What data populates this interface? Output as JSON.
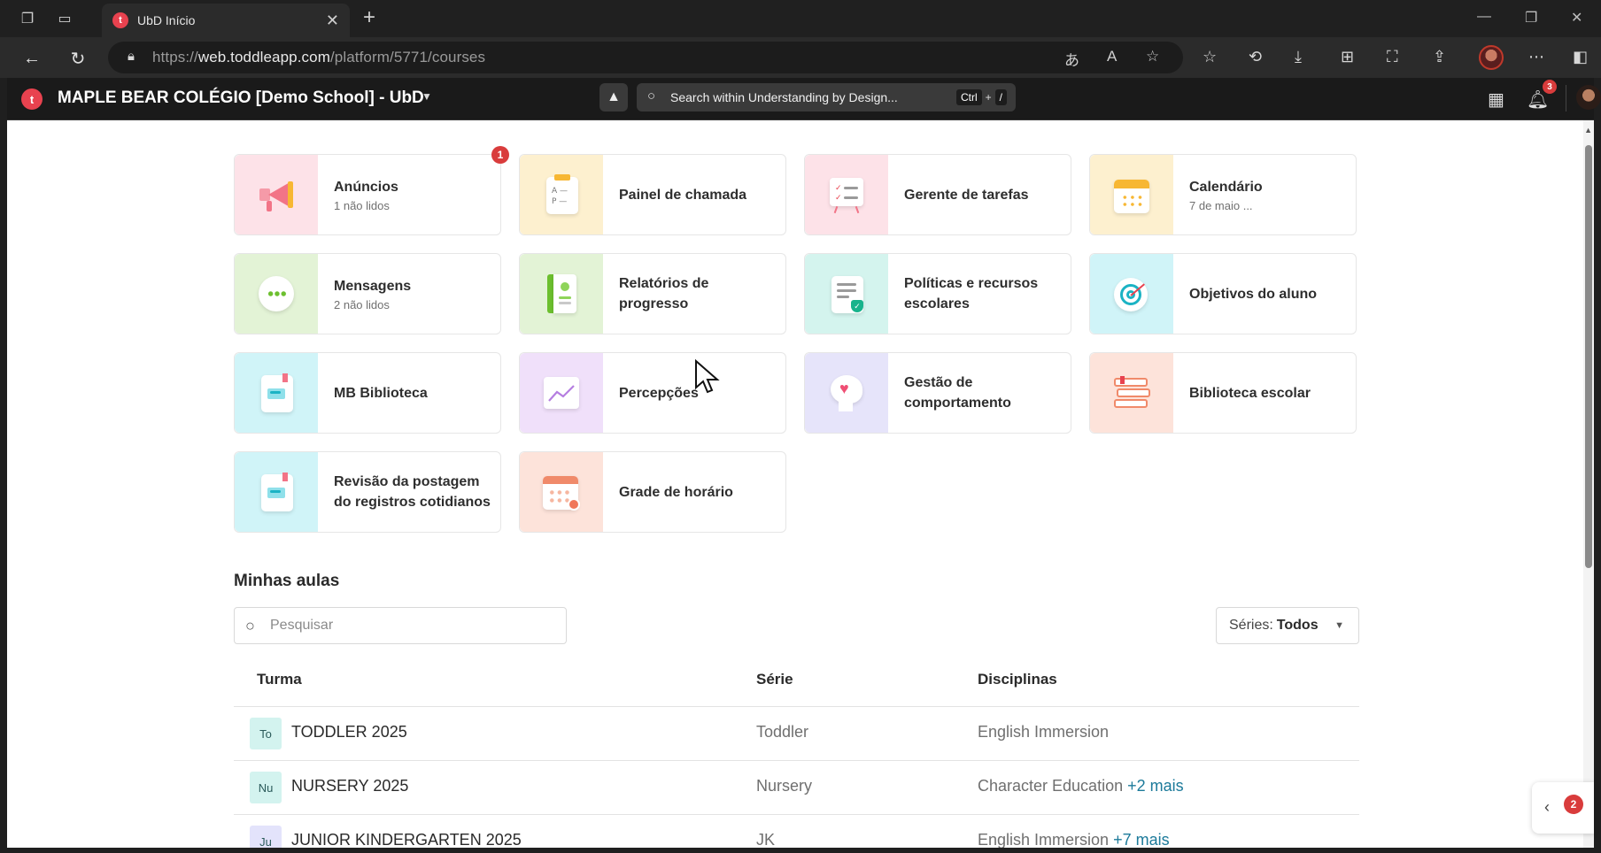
{
  "browser": {
    "tab_title": "UbD Início",
    "url_prefix": "https://",
    "url_domain": "web.toddleapp.com",
    "url_path": "/platform/5771/courses"
  },
  "app": {
    "school_name": "MAPLE BEAR COLÉGIO [Demo School] - UbD",
    "search_placeholder": "Search within Understanding by Design...",
    "shortcut_ctrl": "Ctrl",
    "shortcut_plus": "+",
    "shortcut_key": "/",
    "notifications_count": "3"
  },
  "tiles": [
    {
      "title": "Anúncios",
      "subtitle": "1 não lidos",
      "badge": "1",
      "icon": "megaphone-icon",
      "bg": "#fde2e8"
    },
    {
      "title": "Painel de chamada",
      "subtitle": "",
      "badge": "",
      "icon": "attendance-clipboard-icon",
      "bg": "#fdf0cf"
    },
    {
      "title": "Gerente de tarefas",
      "subtitle": "",
      "badge": "",
      "icon": "task-board-icon",
      "bg": "#fde2e8"
    },
    {
      "title": "Calendário",
      "subtitle": "7 de maio ...",
      "badge": "",
      "icon": "calendar-icon",
      "bg": "#fdf0cf"
    },
    {
      "title": "Mensagens",
      "subtitle": "2 não lidos",
      "badge": "",
      "icon": "chat-bubble-icon",
      "bg": "#e3f3d6"
    },
    {
      "title": "Relatórios de progresso",
      "subtitle": "",
      "badge": "",
      "icon": "report-book-icon",
      "bg": "#e3f3d6"
    },
    {
      "title": "Políticas e recursos escolares",
      "subtitle": "",
      "badge": "",
      "icon": "policy-document-icon",
      "bg": "#d4f4ee"
    },
    {
      "title": "Objetivos do aluno",
      "subtitle": "",
      "badge": "",
      "icon": "target-icon",
      "bg": "#d0f4f8"
    },
    {
      "title": "MB Biblioteca",
      "subtitle": "",
      "badge": "",
      "icon": "notebook-icon",
      "bg": "#d0f4f8"
    },
    {
      "title": "Percepções",
      "subtitle": "",
      "badge": "",
      "icon": "insights-chart-icon",
      "bg": "#f0e0fa"
    },
    {
      "title": "Gestão de comportamento",
      "subtitle": "",
      "badge": "",
      "icon": "head-heart-icon",
      "bg": "#e6e4fa"
    },
    {
      "title": "Biblioteca escolar",
      "subtitle": "",
      "badge": "",
      "icon": "book-stack-icon",
      "bg": "#fde3da"
    },
    {
      "title": "Revisão da postagem do registros cotidianos",
      "subtitle": "",
      "badge": "",
      "icon": "notebook-icon",
      "bg": "#d0f4f8"
    },
    {
      "title": "Grade de horário",
      "subtitle": "",
      "badge": "",
      "icon": "timetable-icon",
      "bg": "#fde3da"
    }
  ],
  "classes_section": {
    "title": "Minhas aulas",
    "search_placeholder": "Pesquisar",
    "filter_label": "Séries:",
    "filter_value": "Todos",
    "columns": [
      "Turma",
      "Série",
      "Disciplinas"
    ],
    "rows": [
      {
        "chip": "To",
        "chip_color": "#d3f3ef",
        "name": "TODDLER 2025",
        "grade": "Toddler",
        "subjects": "English Immersion",
        "more": ""
      },
      {
        "chip": "Nu",
        "chip_color": "#d3f3ef",
        "name": "NURSERY 2025",
        "grade": "Nursery",
        "subjects": "Character Education",
        "more": "+2 mais"
      },
      {
        "chip": "Ju",
        "chip_color": "#e3e3fb",
        "name": "JUNIOR KINDERGARTEN 2025",
        "grade": "JK",
        "subjects": "English Immersion",
        "more": "+7 mais"
      }
    ]
  },
  "side_widget_badge": "2"
}
